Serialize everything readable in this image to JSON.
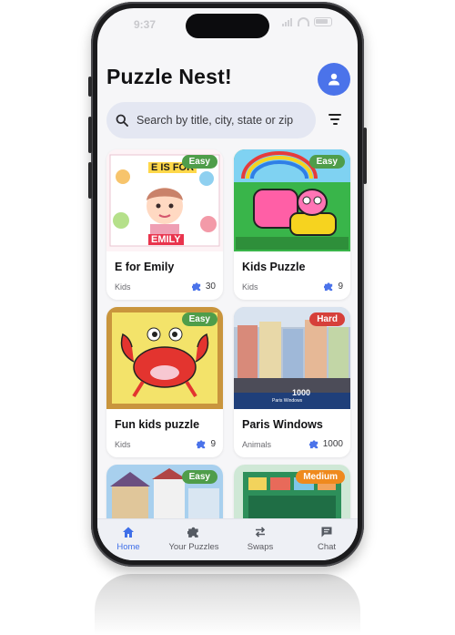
{
  "status_bar": {
    "time": "9:37"
  },
  "header": {
    "title": "Puzzle Nest!"
  },
  "search": {
    "placeholder": "Search by title, city, state or zip"
  },
  "puzzles": [
    {
      "title": "E for Emily",
      "category": "Kids",
      "pieces": "30",
      "difficulty": "Easy",
      "image_text_top": "E IS FOR",
      "image_text_bottom": "EMILY"
    },
    {
      "title": "Kids Puzzle",
      "category": "Kids",
      "pieces": "9",
      "difficulty": "Easy"
    },
    {
      "title": "Fun kids puzzle",
      "category": "Kids",
      "pieces": "9",
      "difficulty": "Easy"
    },
    {
      "title": "Paris Windows",
      "category": "Animals",
      "pieces": "1000",
      "difficulty": "Hard",
      "image_text_top": "1000",
      "image_text_bottom": "Paris Windows"
    },
    {
      "difficulty": "Easy"
    },
    {
      "difficulty": "Medium"
    }
  ],
  "nav": {
    "items": [
      {
        "label": "Home",
        "icon": "home-icon",
        "active": true
      },
      {
        "label": "Your Puzzles",
        "icon": "puzzle-icon",
        "active": false
      },
      {
        "label": "Swaps",
        "icon": "swap-icon",
        "active": false
      },
      {
        "label": "Chat",
        "icon": "chat-icon",
        "active": false
      }
    ]
  },
  "colors": {
    "accent": "#4b73ea",
    "easy": "#4f9d4a",
    "hard": "#d63f3a",
    "medium": "#ef8a1e",
    "background": "#f6f6f8"
  }
}
